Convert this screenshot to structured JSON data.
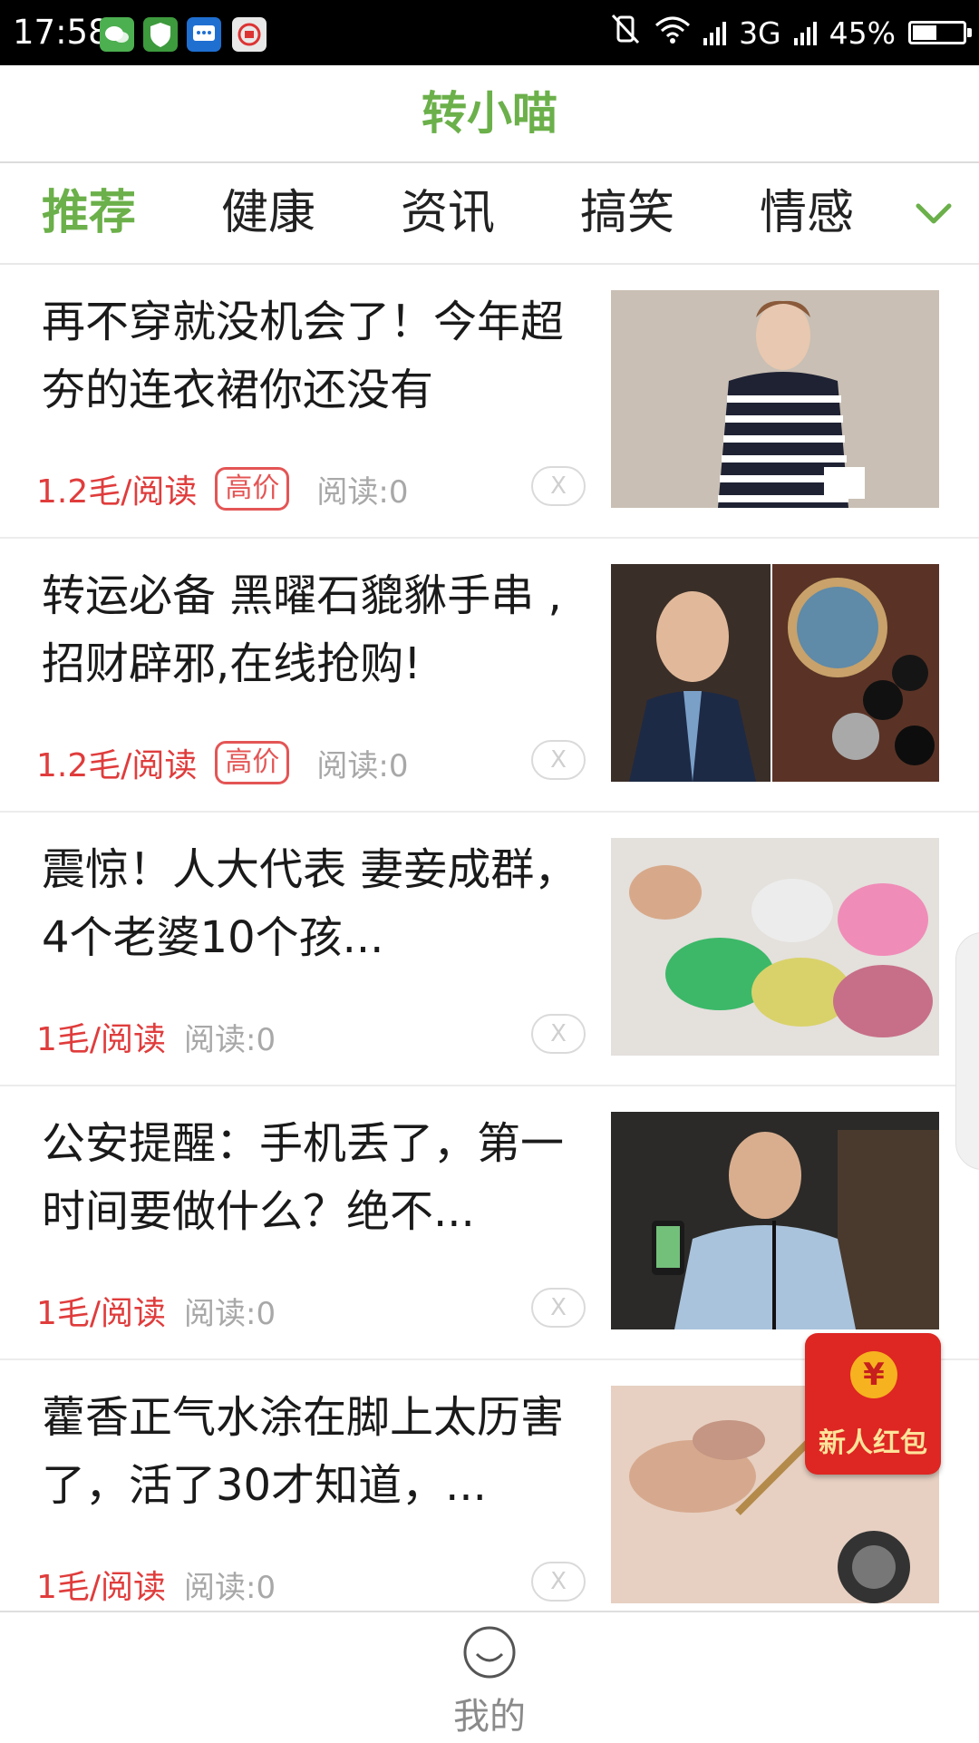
{
  "status_bar": {
    "time": "17:58",
    "network": "3G",
    "battery": "45%",
    "battery_level": 0.45,
    "icons": [
      "wechat-icon",
      "shield-icon",
      "message-icon",
      "app-icon",
      "mute-icon",
      "wifi-icon",
      "signal-icon",
      "battery-icon"
    ]
  },
  "app": {
    "title": "转小喵"
  },
  "tabs": [
    {
      "label": "推荐",
      "active": true
    },
    {
      "label": "健康",
      "active": false
    },
    {
      "label": "资讯",
      "active": false
    },
    {
      "label": "搞笑",
      "active": false
    },
    {
      "label": "情感",
      "active": false
    }
  ],
  "feed": [
    {
      "title": "再不穿就没机会了！今年超夯的连衣裙你还没有",
      "price": "1.2毛/阅读",
      "badge": "高价",
      "reads": "阅读:0",
      "dismiss": "X"
    },
    {
      "title": "转运必备 黑曜石貔貅手串 ,招财辟邪,在线抢购!",
      "price": "1.2毛/阅读",
      "badge": "高价",
      "reads": "阅读:0",
      "dismiss": "X"
    },
    {
      "title": "震惊！人大代表 妻妾成群，4个老婆10个孩...",
      "price": "1毛/阅读",
      "badge": "",
      "reads": "阅读:0",
      "dismiss": "X"
    },
    {
      "title": "公安提醒：手机丢了，第一时间要做什么？绝不...",
      "price": "1毛/阅读",
      "badge": "",
      "reads": "阅读:0",
      "dismiss": "X"
    },
    {
      "title": "藿香正气水涂在脚上太历害了，活了30才知道，...",
      "price": "1毛/阅读",
      "badge": "",
      "reads": "阅读:0",
      "dismiss": "X"
    }
  ],
  "red_packet": {
    "coin": "¥",
    "label": "新人红包"
  },
  "bottom_nav": {
    "mine": "我的"
  },
  "colors": {
    "accent": "#6bb04a",
    "price": "#e03c3c",
    "muted": "#a8a8a8",
    "redpacket": "#de2622"
  }
}
